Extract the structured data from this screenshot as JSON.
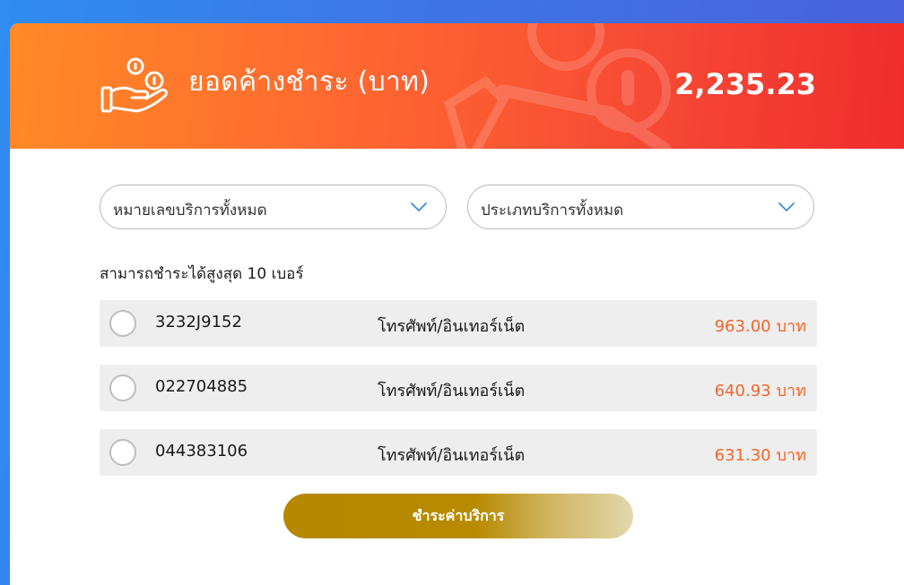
{
  "header": {
    "title": "ยอดค้างชำระ (บาท)",
    "total_amount": "2,235.23",
    "icon": "hand-coins-icon"
  },
  "filters": {
    "number_dropdown": {
      "label": "หมายเลขบริการทั้งหมด",
      "icon": "chevron-down-icon"
    },
    "type_dropdown": {
      "label": "ประเภทบริการทั้งหมด",
      "icon": "chevron-down-icon"
    }
  },
  "limit_text": "สามารถชำระได้สูงสุด 10 เบอร์",
  "bills": [
    {
      "number": "3232J9152",
      "service": "โทรศัพท์/อินเทอร์เน็ต",
      "amount": "963.00",
      "unit": "บาท",
      "selected": false
    },
    {
      "number": "022704885",
      "service": "โทรศัพท์/อินเทอร์เน็ต",
      "amount": "640.93",
      "unit": "บาท",
      "selected": false
    },
    {
      "number": "044383106",
      "service": "โทรศัพท์/อินเทอร์เน็ต",
      "amount": "631.30",
      "unit": "บาท",
      "selected": false
    }
  ],
  "pay_button": {
    "label": "ชำระค่าบริการ"
  },
  "colors": {
    "banner_start": "#ff8a26",
    "banner_end": "#ee2b2c",
    "amount_accent": "#f4652b",
    "button_gold": "#b58800",
    "page_background": "#3f74e6"
  }
}
